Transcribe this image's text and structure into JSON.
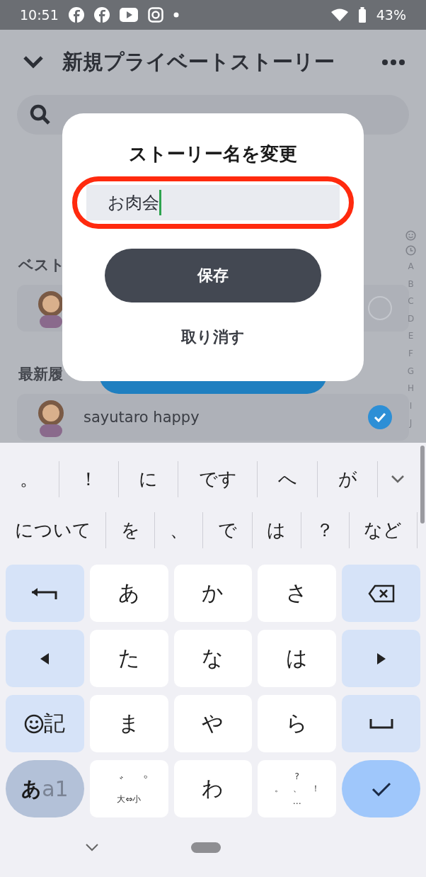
{
  "status_bar": {
    "time": "10:51",
    "battery": "43%"
  },
  "header": {
    "title": "新規プライベートストーリー"
  },
  "sections": [
    {
      "label": "ベスト",
      "friends": [
        {
          "selected": false
        }
      ]
    },
    {
      "label": "最新履",
      "friends": [
        {
          "name": "sayutaro happy",
          "selected": true
        }
      ]
    }
  ],
  "index_letters": [
    "A",
    "B",
    "C",
    "D",
    "E",
    "F",
    "G",
    "H",
    "I",
    "J"
  ],
  "dialog": {
    "title": "ストーリー名を変更",
    "value": "お肉会",
    "highlighted": true,
    "save": "保存",
    "cancel": "取り消す"
  },
  "candidates": [
    [
      "。",
      "！",
      "に",
      "です",
      "へ",
      "が"
    ],
    [
      "について",
      "を",
      "、",
      "で",
      "は",
      "？",
      "など"
    ]
  ],
  "keys": [
    {
      "kind": "back"
    },
    {
      "kind": "char",
      "label": "あ"
    },
    {
      "kind": "char",
      "label": "か"
    },
    {
      "kind": "char",
      "label": "さ"
    },
    {
      "kind": "delete"
    },
    {
      "kind": "left"
    },
    {
      "kind": "char",
      "label": "た"
    },
    {
      "kind": "char",
      "label": "な"
    },
    {
      "kind": "char",
      "label": "は"
    },
    {
      "kind": "right"
    },
    {
      "kind": "emoji",
      "label": "記"
    },
    {
      "kind": "char",
      "label": "ま"
    },
    {
      "kind": "char",
      "label": "や"
    },
    {
      "kind": "char",
      "label": "ら"
    },
    {
      "kind": "space"
    },
    {
      "kind": "mode",
      "label": "あ",
      "label2": "a1"
    },
    {
      "kind": "dakuten",
      "marks": [
        "゛",
        "゜"
      ],
      "label": "大⇔小"
    },
    {
      "kind": "char",
      "label": "わ"
    },
    {
      "kind": "punct",
      "top": "?",
      "marks": [
        "。",
        "、",
        "！"
      ],
      "bottom": "…"
    },
    {
      "kind": "enter"
    }
  ]
}
